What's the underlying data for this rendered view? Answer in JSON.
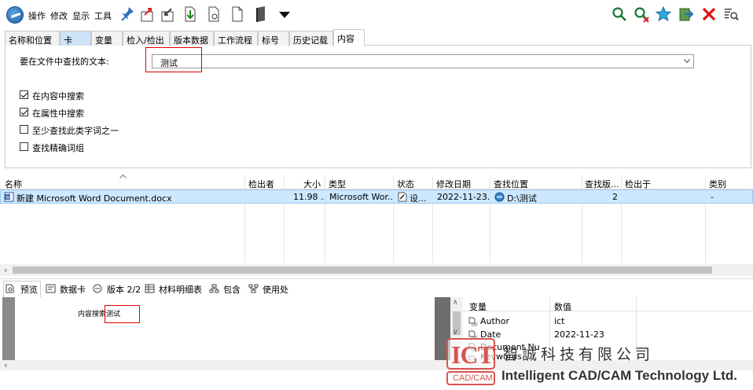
{
  "menu": [
    "操作",
    "修改",
    "显示",
    "工具"
  ],
  "tabs": [
    "名称和位置",
    "卡",
    "变量",
    "检入/检出",
    "版本数据",
    "工作流程",
    "标号",
    "历史记载",
    "内容"
  ],
  "search": {
    "label": "要在文件中查找的文本:",
    "value": "测试"
  },
  "options": [
    {
      "label": "在内容中搜索",
      "checked": true
    },
    {
      "label": "在属性中搜索",
      "checked": true
    },
    {
      "label": "至少查找此类字词之一",
      "checked": false
    },
    {
      "label": "查找精确词组",
      "checked": false
    }
  ],
  "columns": [
    "名称",
    "检出者",
    "大小",
    "类型",
    "状态",
    "修改日期",
    "查找位置",
    "查找版...",
    "检出于",
    "类别"
  ],
  "row": {
    "name": "新建 Microsoft Word Document.docx",
    "checked_out_by": "",
    "size": "11.98 ...",
    "type": "Microsoft Wor...",
    "status": "设...",
    "modified": "2022-11-23...",
    "location": "D:\\测试",
    "found_version": "2",
    "checked_out_in": "",
    "category": "-"
  },
  "bottom_tabs": [
    "预览",
    "数据卡",
    "版本 2/2",
    "材料明细表",
    "包含",
    "使用处"
  ],
  "preview_text": "内容搜索测试",
  "props": {
    "headers": [
      "变量",
      "数值"
    ],
    "rows": [
      {
        "name": "Author",
        "value": "ict"
      },
      {
        "name": "Date",
        "value": "2022-11-23"
      },
      {
        "name": "Document Nu",
        "value": ""
      },
      {
        "name": "Keywords",
        "value": ""
      }
    ]
  },
  "watermark": {
    "company_cn": "智誠科技有限公司",
    "company_en": "Intelligent CAD/CAM Technology Ltd.",
    "logo_sub": "CAD/CAM"
  },
  "colors": {
    "accent": "#cce8ff",
    "red": "#e00000",
    "brand": "#d9544f"
  }
}
